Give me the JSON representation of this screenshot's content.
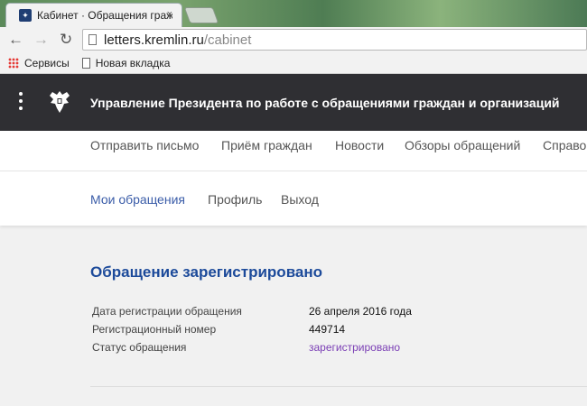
{
  "browser": {
    "tab_title": "Кабинет · Обращения граж",
    "tab_close": "×",
    "url_host": "letters.kremlin.ru",
    "url_path": "/cabinet",
    "bookmarks": [
      {
        "label": "Сервисы"
      },
      {
        "label": "Новая вкладка"
      }
    ]
  },
  "header": {
    "title": "Управление Президента по работе с обращениями граждан и организаций"
  },
  "mainnav": {
    "items": [
      "Отправить письмо",
      "Приём граждан",
      "Новости",
      "Обзоры обращений",
      "Справо"
    ]
  },
  "subnav": {
    "items": [
      "Мои обращения",
      "Профиль",
      "Выход"
    ],
    "active": "Мои обращения"
  },
  "content": {
    "title": "Обращение зарегистрировано",
    "rows": [
      {
        "label": "Дата регистрации обращения",
        "value": "26 апреля 2016 года"
      },
      {
        "label": "Регистрационный номер",
        "value": "449714"
      },
      {
        "label": "Статус обращения",
        "value": "зарегистрировано"
      }
    ]
  },
  "colors": {
    "header_bg": "#2f2f33",
    "title_blue": "#1c4a9a",
    "active_link": "#3a5ca8",
    "status_purple": "#7b3fb5"
  }
}
